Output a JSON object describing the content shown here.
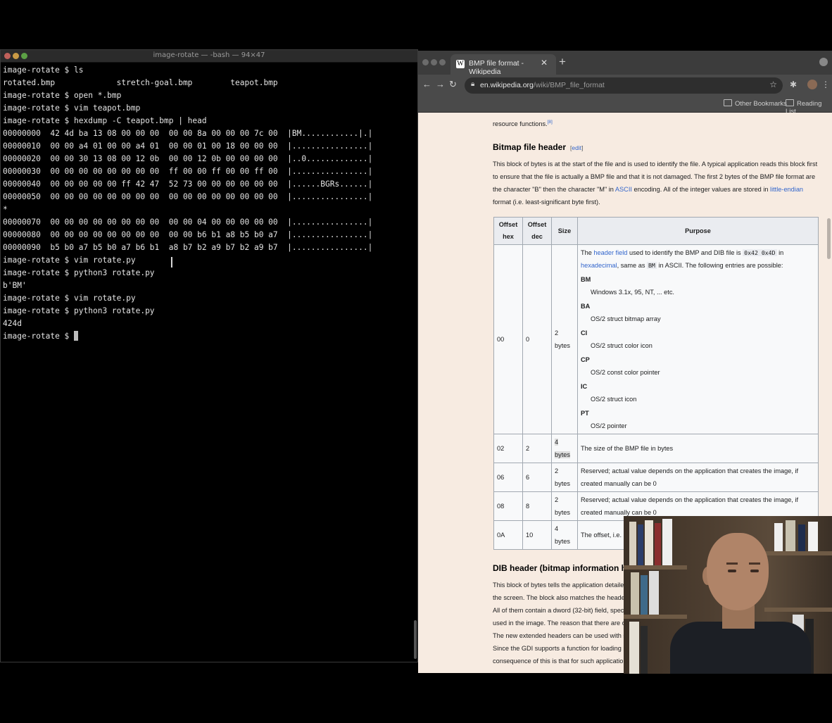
{
  "terminal": {
    "title": "image-rotate — -bash — 94×47",
    "lines": [
      "image-rotate $ ls",
      "rotated.bmp             stretch-goal.bmp        teapot.bmp",
      "image-rotate $ open *.bmp",
      "image-rotate $ vim teapot.bmp",
      "image-rotate $ hexdump -C teapot.bmp | head",
      "00000000  42 4d ba 13 08 00 00 00  00 00 8a 00 00 00 7c 00  |BM............|.|",
      "00000010  00 00 a4 01 00 00 a4 01  00 00 01 00 18 00 00 00  |................|",
      "00000020  00 00 30 13 08 00 12 0b  00 00 12 0b 00 00 00 00  |..0.............|",
      "00000030  00 00 00 00 00 00 00 00  ff 00 00 ff 00 00 ff 00  |................|",
      "00000040  00 00 00 00 00 ff 42 47  52 73 00 00 00 00 00 00  |......BGRs......|",
      "00000050  00 00 00 00 00 00 00 00  00 00 00 00 00 00 00 00  |................|",
      "*",
      "00000070  00 00 00 00 00 00 00 00  00 00 04 00 00 00 00 00  |................|",
      "00000080  00 00 00 00 00 00 00 00  00 00 b6 b1 a8 b5 b0 a7  |................|",
      "00000090  b5 b0 a7 b5 b0 a7 b6 b1  a8 b7 b2 a9 b7 b2 a9 b7  |................|",
      "image-rotate $ vim rotate.py",
      "image-rotate $ python3 rotate.py",
      "b'BM'",
      "image-rotate $ vim rotate.py",
      "image-rotate $ python3 rotate.py",
      "424d",
      "image-rotate $ "
    ],
    "colors": {
      "close": "#ff5f57",
      "min": "#febc2e",
      "max": "#28c840"
    }
  },
  "browser": {
    "tab_title": "BMP file format - Wikipedia",
    "tab_favicon": "W",
    "url_host": "en.wikipedia.org",
    "url_path": "/wiki/BMP_file_format",
    "bookmarks": [
      "Other Bookmarks",
      "Reading List"
    ]
  },
  "article": {
    "top_text": "resource functions.",
    "top_ref": "[8]",
    "section1_title": "Bitmap file header",
    "edit_label": "edit",
    "section1_para_parts": [
      "This block of bytes is at the start of the file and is used to identify the file. A typical application reads this block first to ensure that the file is actually a BMP file and that it is not damaged. The first 2 bytes of the BMP file format are the character \"B\" then the character \"M\" in ",
      "ASCII",
      " encoding. All of the integer values are stored in ",
      "little-endian",
      " format (i.e. least-significant byte first)."
    ],
    "table": {
      "headers": [
        "Offset hex",
        "Offset dec",
        "Size",
        "Purpose"
      ],
      "row0": {
        "hex": "00",
        "dec": "0",
        "size": "2 bytes",
        "p1": "The ",
        "link1": "header field",
        "p2": " used to identify the BMP and DIB file is ",
        "code1": "0x42 0x4D",
        "p3": " in ",
        "link2": "hexadecimal",
        "p4": ", same as ",
        "code2": "BM",
        "p5": " in ASCII. The following entries are possible:",
        "entries": [
          {
            "term": "BM",
            "desc": "Windows 3.1x, 95, NT, ... etc."
          },
          {
            "term": "BA",
            "desc": "OS/2 struct bitmap array"
          },
          {
            "term": "CI",
            "desc": "OS/2 struct color icon"
          },
          {
            "term": "CP",
            "desc": "OS/2 const color pointer"
          },
          {
            "term": "IC",
            "desc": "OS/2 struct icon"
          },
          {
            "term": "PT",
            "desc": "OS/2 pointer"
          }
        ]
      },
      "rows": [
        {
          "hex": "02",
          "dec": "2",
          "size": "4 bytes",
          "purpose": "The size of the BMP file in bytes"
        },
        {
          "hex": "06",
          "dec": "6",
          "size": "2 bytes",
          "purpose": "Reserved; actual value depends on the application that creates the image, if created manually can be 0"
        },
        {
          "hex": "08",
          "dec": "8",
          "size": "2 bytes",
          "purpose": "Reserved; actual value depends on the application that creates the image, if created manually can be 0"
        },
        {
          "hex": "0A",
          "dec": "10",
          "size": "4 bytes",
          "purpose": "The offset, i.e. st can be found."
        }
      ]
    },
    "section2_title": "DIB header (bitmap information heade",
    "section2_lines": [
      "This block of bytes tells the application detailed in",
      "the screen. The block also matches the header u",
      "All of them contain a dword (32-bit) field, specifyi",
      "used in the image. The reason that there are diffe",
      "The new extended headers can be used with sor",
      "Since the GDI supports a function for loading bitn",
      "consequence of this is that for such applications,"
    ]
  }
}
